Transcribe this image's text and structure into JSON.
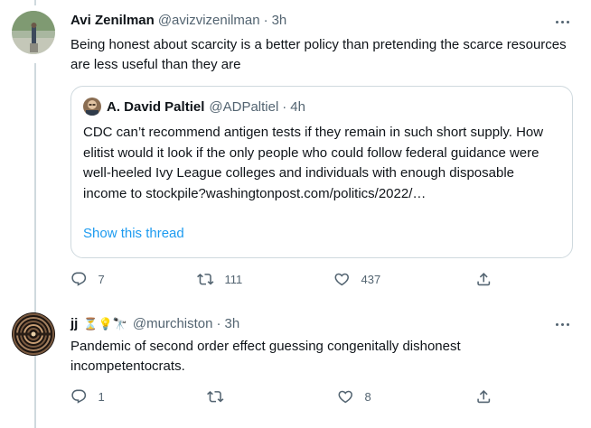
{
  "tweets": [
    {
      "name": "Avi Zenilman",
      "handle": "@avizvizenilman",
      "time": "3h",
      "text": "Being honest about scarcity is a better policy than pretending the scarce resources are less useful than they are",
      "quote": {
        "name": "A. David Paltiel",
        "handle": "@ADPaltiel",
        "time": "4h",
        "text": "CDC can’t recommend antigen tests if they remain in such short supply. How elitist would it look if the only people who could follow federal guidance were well-heeled Ivy League colleges and individuals with enough disposable income to stockpile?washingtonpost.com/politics/2022/…",
        "show_thread": "Show this thread"
      },
      "actions": {
        "replies": "7",
        "retweets": "111",
        "likes": "437"
      }
    },
    {
      "name": "jj",
      "emojis": "⏳💡🔭",
      "handle": "@murchiston",
      "time": "3h",
      "text": "Pandemic of second order effect guessing congenitally dishonest incompetentocrats.",
      "actions": {
        "replies": "1",
        "retweets": "",
        "likes": "8"
      }
    }
  ],
  "sep": "·",
  "icons": [
    "more-icon",
    "reply-icon",
    "retweet-icon",
    "like-icon",
    "share-icon"
  ],
  "colors": {
    "text": "#0f1419",
    "secondary": "#536471",
    "link": "#1d9bf0",
    "border": "#cfd9de"
  }
}
